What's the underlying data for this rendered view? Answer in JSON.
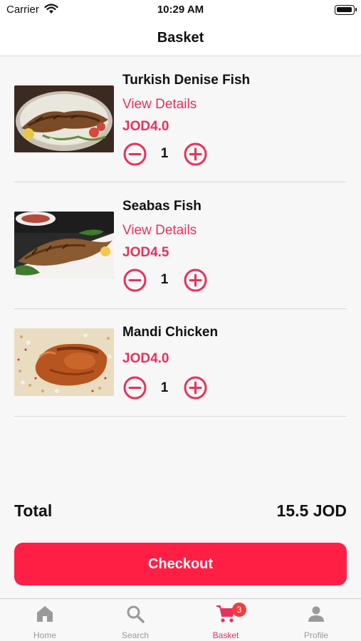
{
  "status": {
    "carrier": "Carrier",
    "time": "10:29 AM"
  },
  "nav": {
    "title": "Basket"
  },
  "items": [
    {
      "name": "Turkish Denise Fish",
      "link": "View Details",
      "price": "JOD4.0",
      "qty": "1",
      "image": "grilled-fish-plate"
    },
    {
      "name": "Seabas Fish",
      "link": "View Details",
      "price": "JOD4.5",
      "qty": "1",
      "image": "seabass-plate"
    },
    {
      "name": "Mandi Chicken",
      "price": "JOD4.0",
      "qty": "1",
      "image": "mandi-chicken-rice"
    }
  ],
  "summary": {
    "total_label": "Total",
    "total_value": "15.5 JOD"
  },
  "checkout": {
    "label": "Checkout"
  },
  "tabs": [
    {
      "label": "Home",
      "icon": "home-icon"
    },
    {
      "label": "Search",
      "icon": "search-icon"
    },
    {
      "label": "Basket",
      "icon": "cart-icon",
      "badge": "3",
      "active": true
    },
    {
      "label": "Profile",
      "icon": "profile-icon"
    }
  ],
  "colors": {
    "accent": "#e8315a",
    "button": "#ff1f45",
    "badge": "#f43c3c"
  }
}
